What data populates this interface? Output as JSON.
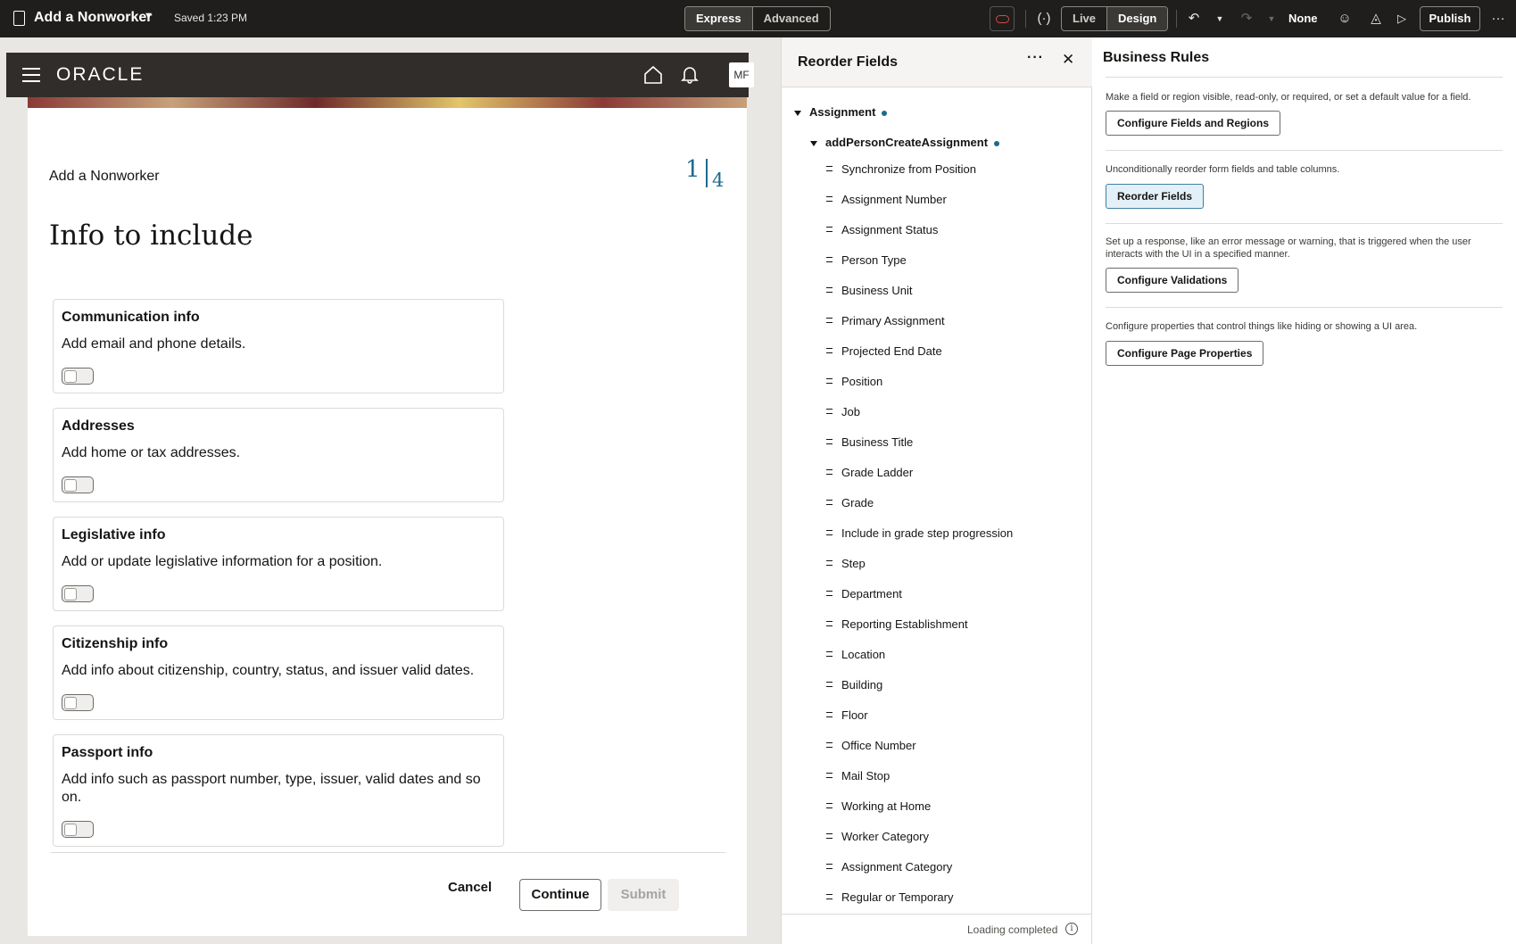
{
  "topbar": {
    "title": "Add a Nonworker",
    "saved": "Saved 1:23 PM",
    "mode_tabs": [
      "Express",
      "Advanced"
    ],
    "view_tabs": [
      "Live",
      "Design"
    ],
    "sandbox": "None",
    "publish": "Publish"
  },
  "app_header": {
    "logo": "ORACLE",
    "avatar": "MF"
  },
  "page": {
    "title": "Add a Nonworker",
    "step_current": "1",
    "step_total": "4",
    "heading": "Info to include",
    "cards": [
      {
        "title": "Communication info",
        "desc": "Add email and phone details."
      },
      {
        "title": "Addresses",
        "desc": "Add home or tax addresses."
      },
      {
        "title": "Legislative info",
        "desc": "Add or update legislative information for a position."
      },
      {
        "title": "Citizenship info",
        "desc": "Add info about citizenship, country, status, and issuer valid dates."
      },
      {
        "title": "Passport info",
        "desc": "Add info such as passport number, type, issuer, valid dates and so on."
      }
    ],
    "cancel": "Cancel",
    "continue": "Continue",
    "submit": "Submit"
  },
  "reorder": {
    "title": "Reorder Fields",
    "root": "Assignment",
    "child": "addPersonCreateAssignment",
    "fields": [
      "Synchronize from Position",
      "Assignment Number",
      "Assignment Status",
      "Person Type",
      "Business Unit",
      "Primary Assignment",
      "Projected End Date",
      "Position",
      "Job",
      "Business Title",
      "Grade Ladder",
      "Grade",
      "Include in grade step progression",
      "Step",
      "Department",
      "Reporting Establishment",
      "Location",
      "Building",
      "Floor",
      "Office Number",
      "Mail Stop",
      "Working at Home",
      "Worker Category",
      "Assignment Category",
      "Regular or Temporary"
    ],
    "footer": "Loading completed"
  },
  "rules": {
    "title": "Business Rules",
    "sections": [
      {
        "desc": "Make a field or region visible, read-only, or required, or set a default value for a field.",
        "button": "Configure Fields and Regions"
      },
      {
        "desc": "Unconditionally reorder form fields and table columns.",
        "button": "Reorder Fields"
      },
      {
        "desc": "Set up a response, like an error message or warning, that is triggered when the user interacts with the UI in a specified manner.",
        "button": "Configure Validations"
      },
      {
        "desc": "Configure properties that control things like hiding or showing a UI area.",
        "button": "Configure Page Properties"
      }
    ]
  }
}
